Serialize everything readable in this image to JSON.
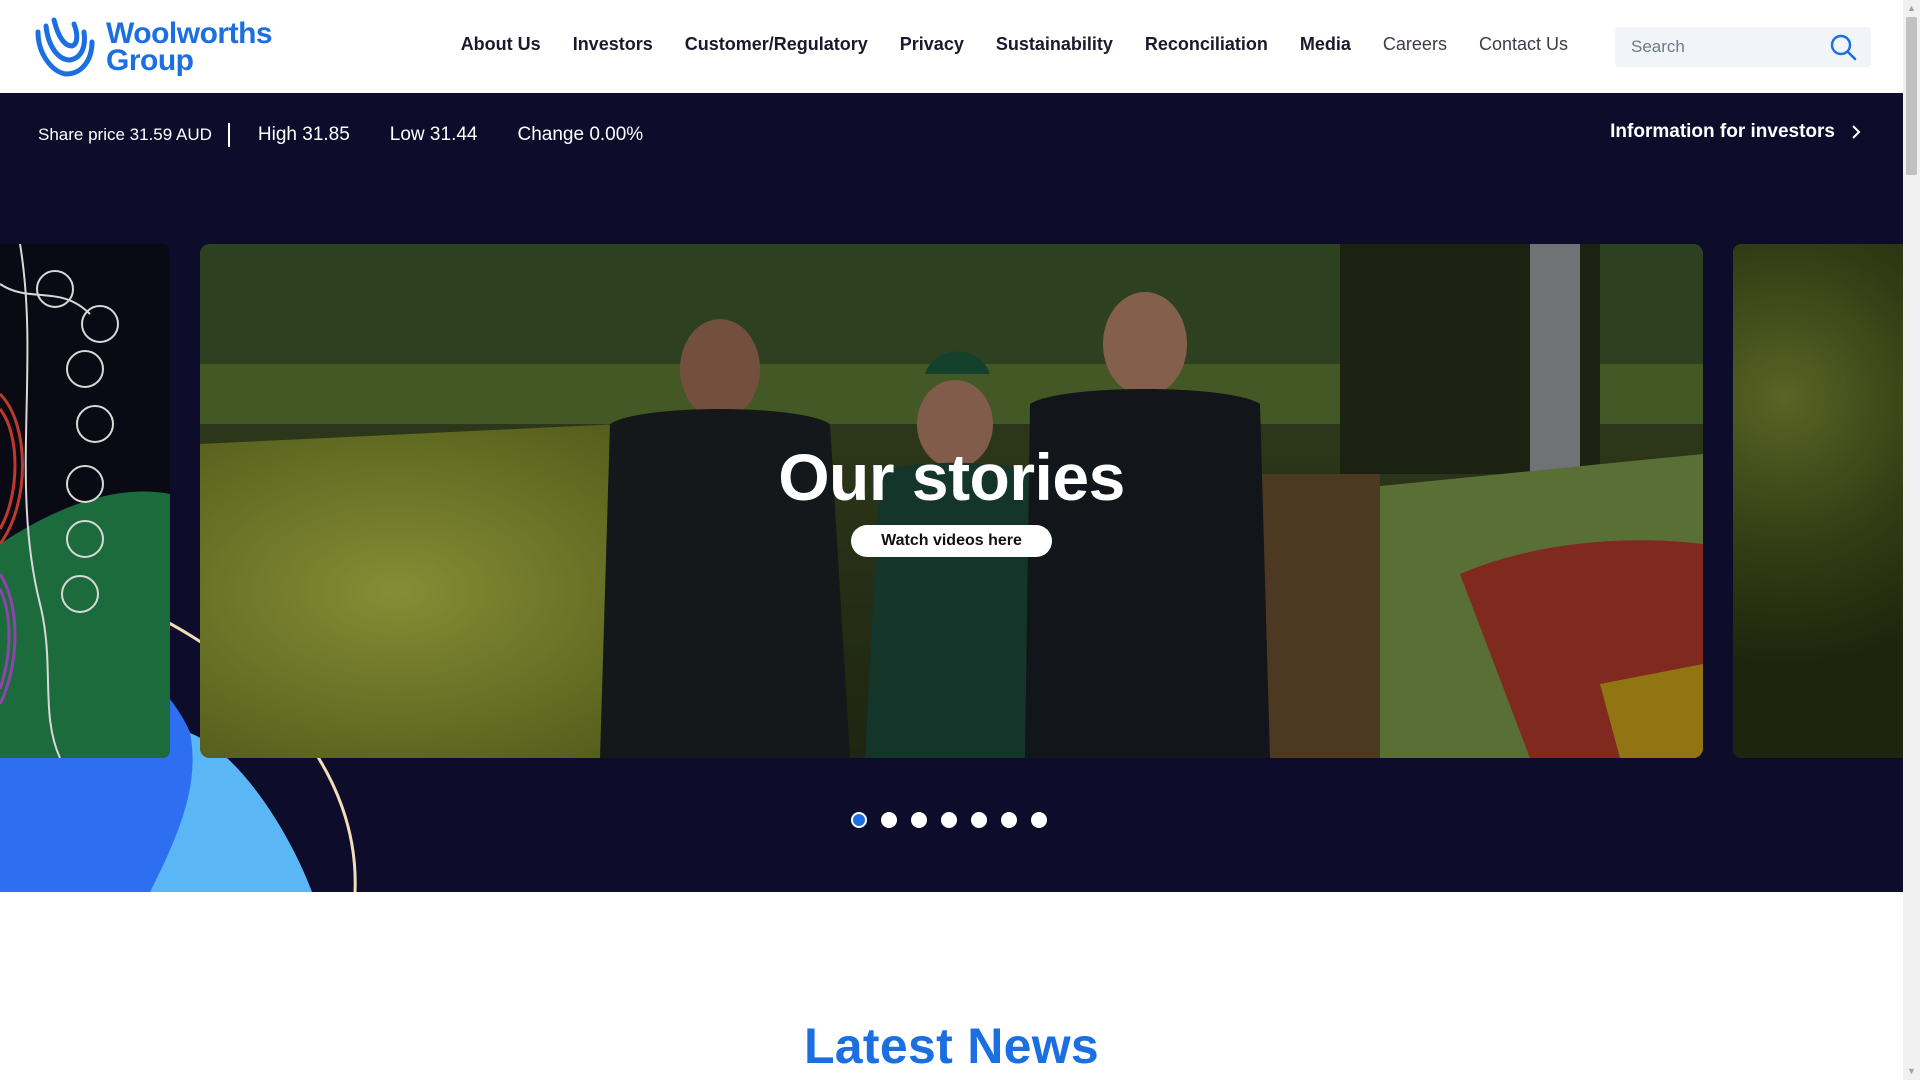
{
  "header": {
    "logo": {
      "line1": "Woolworths",
      "line2": "Group",
      "color": "#1b6fe0"
    },
    "nav": [
      {
        "label": "About Us"
      },
      {
        "label": "Investors"
      },
      {
        "label": "Customer/Regulatory"
      },
      {
        "label": "Privacy"
      },
      {
        "label": "Sustainability"
      },
      {
        "label": "Reconciliation"
      },
      {
        "label": "Media"
      },
      {
        "label": "Careers"
      },
      {
        "label": "Contact Us"
      }
    ],
    "search": {
      "placeholder": "Search",
      "icon": "search-icon"
    }
  },
  "ticker": {
    "share_price": "Share price 31.59 AUD",
    "high": "High 31.85",
    "low": "Low 31.44",
    "change": "Change 0.00%"
  },
  "investor_link": {
    "label": "Information for investors",
    "icon": "chevron-right-icon"
  },
  "carousel": {
    "title": "Our stories",
    "cta": "Watch videos here",
    "slide_count": 7,
    "active_index": 0
  },
  "latest_news": {
    "title": "Latest News"
  },
  "colors": {
    "brand_blue": "#1b6fe0",
    "band_navy": "#0d0d2b",
    "light_blue": "#5bb6f5"
  }
}
